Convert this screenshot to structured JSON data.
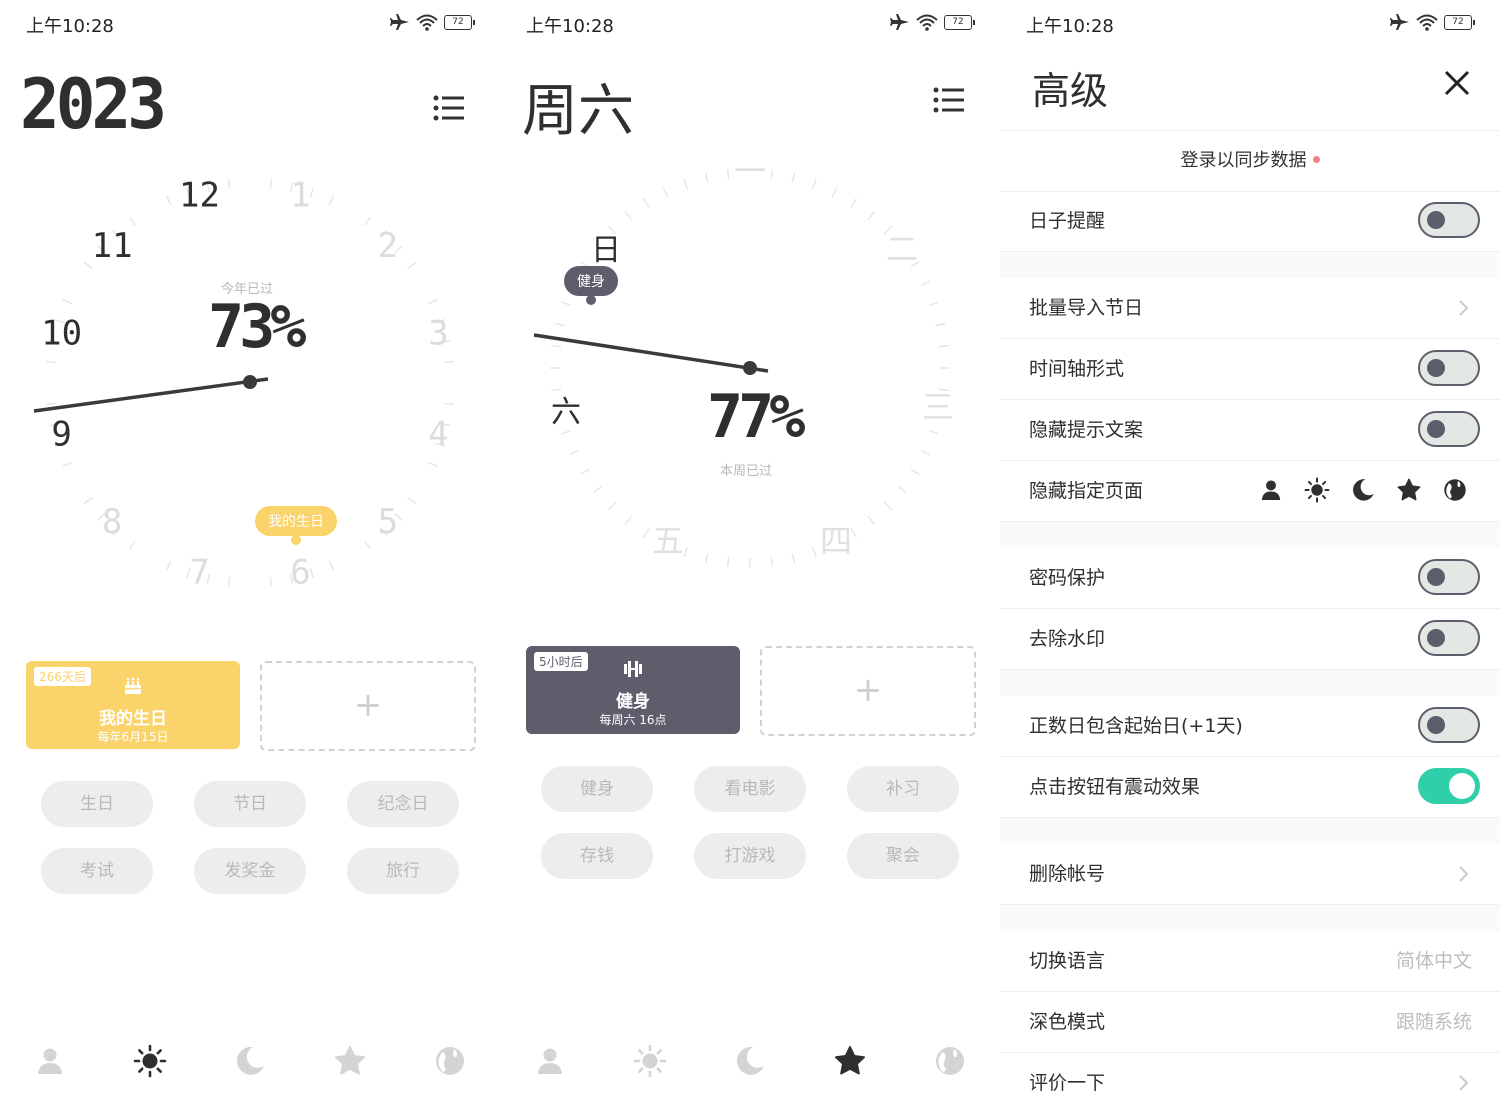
{
  "status": {
    "time": "上午10:28",
    "battery": "72"
  },
  "screen1": {
    "year": "2023",
    "clock_numbers": [
      "12",
      "1",
      "2",
      "3",
      "4",
      "5",
      "6",
      "7",
      "8",
      "9",
      "10",
      "11"
    ],
    "progress_caption": "今年已过",
    "progress_value": "73%",
    "bubble": "我的生日",
    "card": {
      "badge": "266天后",
      "title": "我的生日",
      "subtitle": "每年6月15日",
      "icon": "cake-icon"
    },
    "add_label": "+",
    "chips": [
      "生日",
      "节日",
      "纪念日",
      "考试",
      "发奖金",
      "旅行"
    ]
  },
  "screen2": {
    "weekday": "周六",
    "day_labels": [
      "一",
      "二",
      "三",
      "四",
      "五",
      "六",
      "日"
    ],
    "progress_caption": "本周已过",
    "progress_value": "77%",
    "bubble": "健身",
    "card": {
      "badge": "5小时后",
      "title": "健身",
      "subtitle": "每周六 16点",
      "icon": "dumbbell-icon"
    },
    "add_label": "+",
    "chips": [
      "健身",
      "看电影",
      "补习",
      "存钱",
      "打游戏",
      "聚会"
    ]
  },
  "tabs": [
    "person-icon",
    "sun-icon",
    "moon-icon",
    "star-icon",
    "globe-icon"
  ],
  "settings": {
    "title": "高级",
    "sync_label": "登录以同步数据",
    "rows": {
      "reminder": "日子提醒",
      "import": "批量导入节日",
      "timeline": "时间轴形式",
      "hide_tips": "隐藏提示文案",
      "hide_pages": "隐藏指定页面",
      "password": "密码保护",
      "watermark": "去除水印",
      "include_start": "正数日包含起始日(+1天)",
      "vibration": "点击按钮有震动效果",
      "delete_account": "删除帐号",
      "language": "切换语言",
      "language_value": "简体中文",
      "dark_mode": "深色模式",
      "dark_mode_value": "跟随系统",
      "rate": "评价一下"
    },
    "toggles": {
      "reminder": false,
      "timeline": false,
      "hide_tips": false,
      "password": false,
      "watermark": false,
      "include_start": false,
      "vibration": true
    }
  },
  "colors": {
    "accent_yellow": "#fbd36b",
    "accent_dark": "#5e5d6c",
    "toggle_on": "#2fcfa9",
    "chip_bg": "#ededed"
  }
}
